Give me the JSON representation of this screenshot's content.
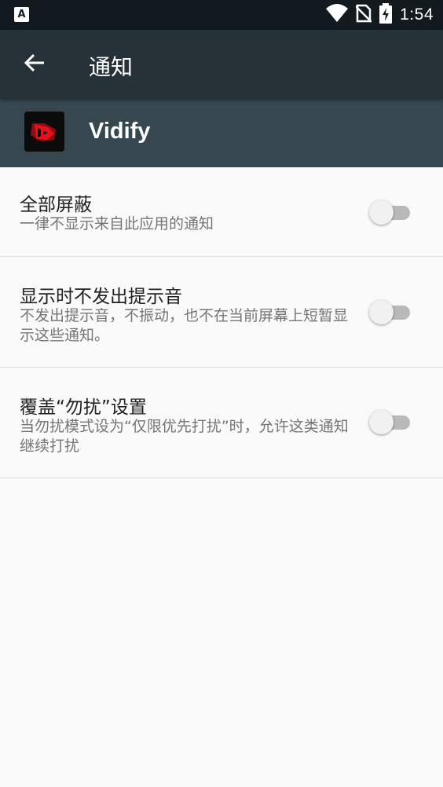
{
  "status_bar": {
    "notification_icon": "a-letter-icon",
    "notification_letter": "A",
    "time": "1:54",
    "icons": [
      "wifi-icon",
      "no-sim-icon",
      "battery-charging-icon"
    ]
  },
  "app_bar": {
    "back_icon": "arrow-left-icon",
    "title": "通知"
  },
  "app_header": {
    "app_name": "Vidify",
    "app_icon": "vidify-logo-icon"
  },
  "settings": [
    {
      "title": "全部屏蔽",
      "summary": "一律不显示来自此应用的通知",
      "enabled": false
    },
    {
      "title": "显示时不发出提示音",
      "summary": "不发出提示音，不振动，也不在当前屏幕上短暂显示这些通知。",
      "enabled": false
    },
    {
      "title": "覆盖“勿扰”设置",
      "summary": "当勿扰模式设为“仅限优先打扰”时，允许这类通知继续打扰",
      "enabled": false
    }
  ],
  "colors": {
    "status_bar": "#121a1f",
    "app_bar": "#263238",
    "app_header": "#37474f",
    "background": "#fafafa",
    "switch_track_off": "#b9b9b9",
    "switch_thumb_off": "#f1f1f1",
    "icon_accent": "#e8101a"
  }
}
